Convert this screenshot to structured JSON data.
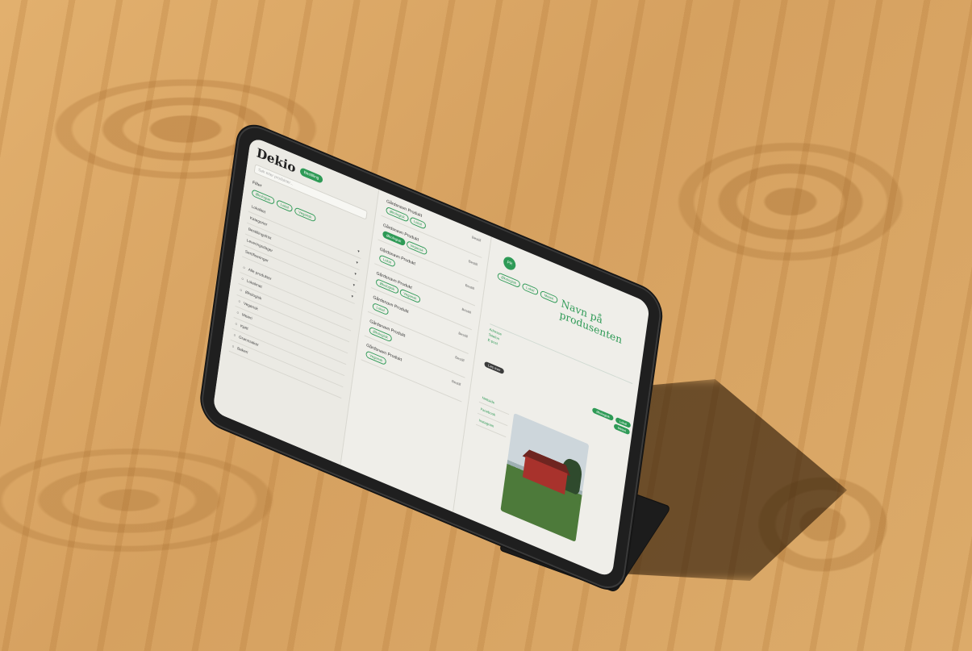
{
  "app": {
    "brand": "Dekio",
    "badge": "Bestilling",
    "search_placeholder": "Søk etter produkter..."
  },
  "producer": {
    "initials": "PR",
    "name": "Navn på produsenten"
  },
  "left_panel": {
    "section_title": "Filter",
    "rows": [
      "Lokalitet",
      "Kategorier",
      "Bestillingsfrist",
      "Leveringsdager",
      "Sertifiseringer"
    ],
    "checklist": [
      "Alle produkter",
      "Lokalmat",
      "Økologisk",
      "Vegansk",
      "Meieri",
      "Kjøtt",
      "Grønnsaker",
      "Bakeri"
    ]
  },
  "mid_panel": {
    "cards": [
      {
        "title": "Gårdsnavn Produkt",
        "link": "Bestill"
      },
      {
        "title": "Gårdsnavn Produkt",
        "link": "Bestill"
      },
      {
        "title": "Gårdsnavn Produkt",
        "link": "Bestill"
      },
      {
        "title": "Gårdsnavn Produkt",
        "link": "Bestill"
      },
      {
        "title": "Gårdsnavn Produkt",
        "link": "Bestill"
      },
      {
        "title": "Gårdsnavn Produkt",
        "link": "Bestill"
      },
      {
        "title": "Gårdsnavn Produkt",
        "link": "Bestill"
      }
    ],
    "chips": [
      "Økologisk",
      "Lokal",
      "Vegansk"
    ]
  },
  "right_panel": {
    "tags": [
      "Økologisk",
      "Lokal",
      "Meieri"
    ],
    "dark_pill": "Les mer",
    "contact": [
      "Adresse",
      "Telefon",
      "E-post"
    ],
    "links": [
      "Nettside",
      "Facebook",
      "Instagram"
    ]
  },
  "colors": {
    "accent": "#2e9a56",
    "screen_bg": "#efeee9",
    "table_wood": "#d9a766"
  }
}
